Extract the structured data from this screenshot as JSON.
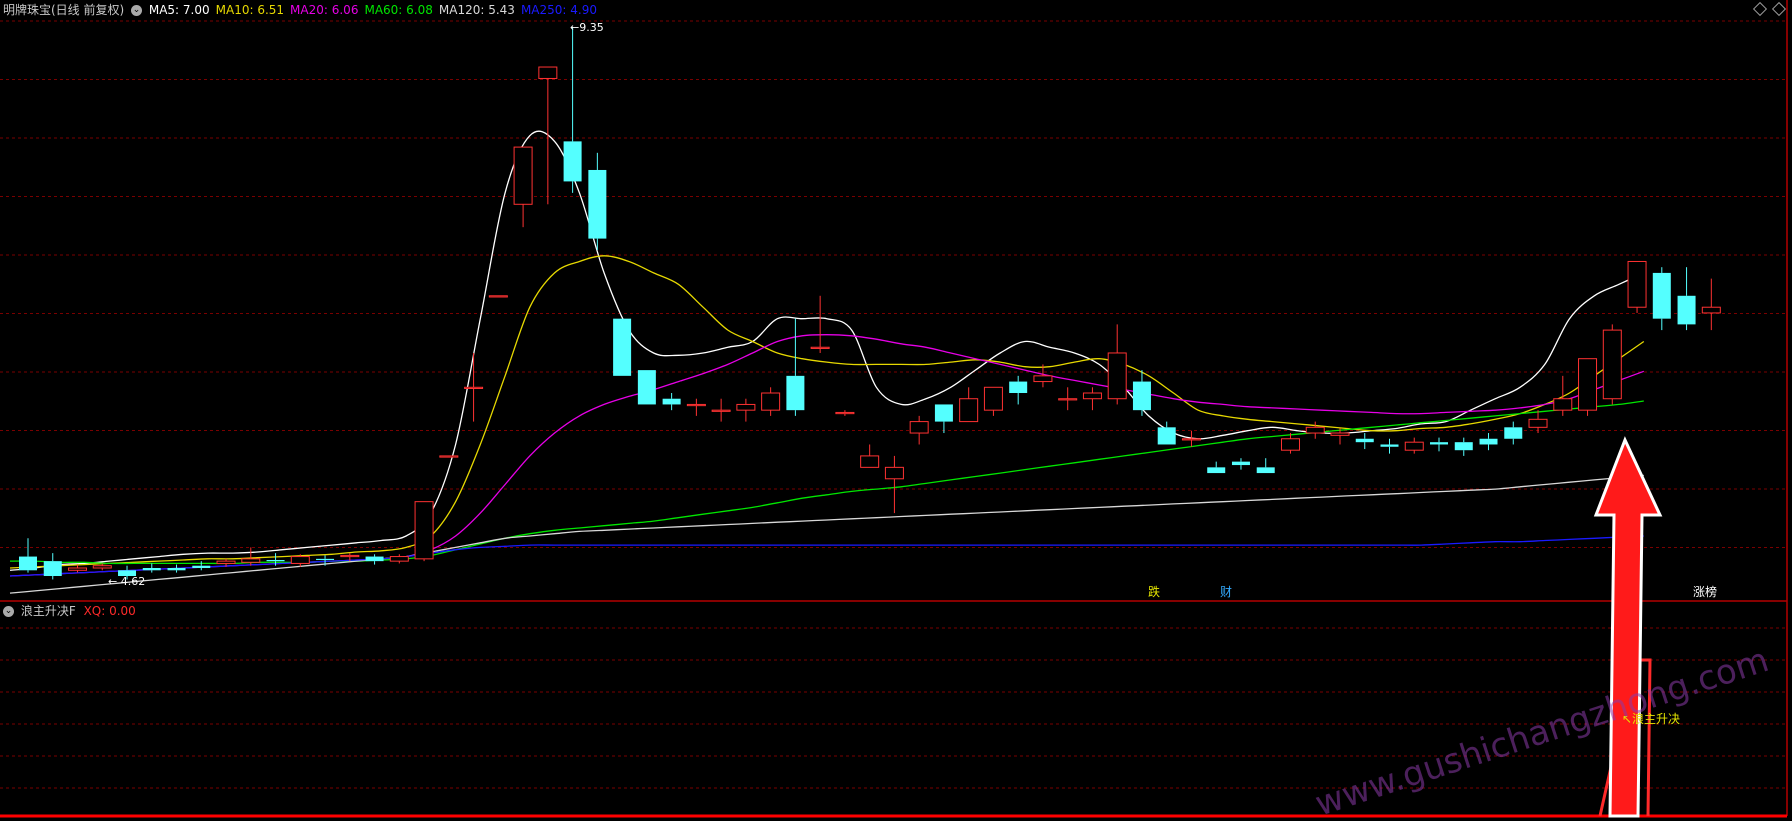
{
  "chart_data": [
    {
      "type": "candlestick",
      "title": "明牌珠宝(日线 前复权)",
      "ylim": [
        4.2,
        9.5
      ],
      "grid": true,
      "moving_averages": [
        {
          "name": "MA5",
          "value": "7.00",
          "color": "#ffffff",
          "values": [
            4.6,
            4.62,
            4.65,
            4.66,
            4.68,
            4.7,
            4.72,
            4.74,
            4.75,
            4.75,
            4.76,
            4.78,
            4.8,
            4.82,
            4.84,
            4.86,
            4.9,
            5.1,
            5.7,
            6.8,
            7.9,
            8.4,
            8.35,
            7.9,
            7.2,
            6.7,
            6.5,
            6.48,
            6.5,
            6.55,
            6.6,
            6.8,
            6.8,
            6.8,
            6.7,
            6.2,
            6.05,
            6.1,
            6.2,
            6.35,
            6.5,
            6.6,
            6.55,
            6.5,
            6.4,
            6.2,
            5.95,
            5.8,
            5.75,
            5.78,
            5.82,
            5.85,
            5.82,
            5.8,
            5.8,
            5.82,
            5.84,
            5.88,
            5.9,
            6.0,
            6.1,
            6.2,
            6.4,
            6.8,
            7.0,
            7.1,
            7.2
          ]
        },
        {
          "name": "MA10",
          "value": "6.51",
          "color": "#e6d800",
          "values": [
            4.62,
            4.63,
            4.64,
            4.65,
            4.66,
            4.67,
            4.68,
            4.69,
            4.7,
            4.7,
            4.71,
            4.72,
            4.73,
            4.74,
            4.76,
            4.77,
            4.8,
            4.9,
            5.2,
            5.7,
            6.3,
            6.9,
            7.2,
            7.3,
            7.35,
            7.3,
            7.2,
            7.1,
            6.9,
            6.7,
            6.6,
            6.5,
            6.45,
            6.42,
            6.4,
            6.4,
            6.4,
            6.4,
            6.42,
            6.44,
            6.42,
            6.38,
            6.38,
            6.42,
            6.45,
            6.4,
            6.3,
            6.15,
            6.0,
            5.95,
            5.92,
            5.9,
            5.88,
            5.86,
            5.84,
            5.82,
            5.82,
            5.84,
            5.85,
            5.88,
            5.92,
            5.97,
            6.05,
            6.15,
            6.3,
            6.45,
            6.6
          ]
        },
        {
          "name": "MA20",
          "value": "6.06",
          "color": "#e600e6",
          "values": [
            4.55,
            4.56,
            4.57,
            4.58,
            4.59,
            4.6,
            4.61,
            4.62,
            4.63,
            4.64,
            4.65,
            4.66,
            4.67,
            4.68,
            4.69,
            4.7,
            4.72,
            4.78,
            4.9,
            5.1,
            5.35,
            5.6,
            5.8,
            5.95,
            6.05,
            6.12,
            6.18,
            6.25,
            6.32,
            6.4,
            6.5,
            6.6,
            6.65,
            6.66,
            6.65,
            6.62,
            6.58,
            6.55,
            6.5,
            6.45,
            6.4,
            6.35,
            6.3,
            6.26,
            6.22,
            6.18,
            6.14,
            6.1,
            6.07,
            6.05,
            6.03,
            6.02,
            6.01,
            6.0,
            5.99,
            5.98,
            5.97,
            5.97,
            5.98,
            5.99,
            6.0,
            6.02,
            6.05,
            6.1,
            6.18,
            6.26,
            6.34
          ]
        },
        {
          "name": "MA60",
          "value": "6.08",
          "color": "#00e600",
          "values": [
            4.68,
            4.68,
            4.67,
            4.67,
            4.66,
            4.66,
            4.66,
            4.66,
            4.66,
            4.66,
            4.67,
            4.67,
            4.67,
            4.68,
            4.68,
            4.69,
            4.7,
            4.73,
            4.78,
            4.83,
            4.88,
            4.92,
            4.95,
            4.97,
            4.99,
            5.01,
            5.03,
            5.06,
            5.09,
            5.12,
            5.15,
            5.19,
            5.23,
            5.26,
            5.29,
            5.31,
            5.33,
            5.36,
            5.39,
            5.42,
            5.45,
            5.48,
            5.51,
            5.54,
            5.57,
            5.6,
            5.63,
            5.66,
            5.69,
            5.72,
            5.75,
            5.77,
            5.79,
            5.81,
            5.83,
            5.85,
            5.87,
            5.89,
            5.91,
            5.93,
            5.95,
            5.97,
            5.99,
            6.01,
            6.03,
            6.05,
            6.08
          ]
        },
        {
          "name": "MA120",
          "value": "5.43",
          "color": "#d8d8d8",
          "values": [
            4.4,
            4.42,
            4.44,
            4.46,
            4.48,
            4.5,
            4.52,
            4.54,
            4.56,
            4.58,
            4.6,
            4.62,
            4.64,
            4.66,
            4.68,
            4.7,
            4.72,
            4.76,
            4.8,
            4.84,
            4.88,
            4.9,
            4.92,
            4.94,
            4.95,
            4.96,
            4.97,
            4.98,
            4.99,
            5.0,
            5.01,
            5.02,
            5.03,
            5.04,
            5.05,
            5.06,
            5.07,
            5.08,
            5.09,
            5.1,
            5.11,
            5.12,
            5.13,
            5.14,
            5.15,
            5.16,
            5.17,
            5.18,
            5.19,
            5.2,
            5.21,
            5.22,
            5.23,
            5.24,
            5.25,
            5.26,
            5.27,
            5.28,
            5.29,
            5.3,
            5.31,
            5.33,
            5.35,
            5.37,
            5.39,
            5.41,
            5.43
          ]
        },
        {
          "name": "MA250",
          "value": "4.90",
          "color": "#1a1aff",
          "values": [
            4.55,
            4.56,
            4.57,
            4.58,
            4.59,
            4.6,
            4.61,
            4.62,
            4.63,
            4.64,
            4.65,
            4.66,
            4.67,
            4.68,
            4.69,
            4.7,
            4.72,
            4.75,
            4.78,
            4.8,
            4.81,
            4.82,
            4.82,
            4.82,
            4.82,
            4.82,
            4.82,
            4.82,
            4.82,
            4.82,
            4.82,
            4.82,
            4.82,
            4.82,
            4.82,
            4.82,
            4.82,
            4.82,
            4.82,
            4.82,
            4.82,
            4.82,
            4.82,
            4.82,
            4.82,
            4.82,
            4.82,
            4.82,
            4.82,
            4.82,
            4.82,
            4.82,
            4.82,
            4.82,
            4.82,
            4.82,
            4.82,
            4.82,
            4.83,
            4.84,
            4.85,
            4.85,
            4.86,
            4.87,
            4.88,
            4.89,
            4.9
          ]
        }
      ],
      "candles": [
        [
          4.72,
          4.6,
          4.88,
          4.58
        ],
        [
          4.68,
          4.55,
          4.75,
          4.52
        ],
        [
          4.6,
          4.62,
          4.65,
          4.58
        ],
        [
          4.62,
          4.64,
          4.66,
          4.6
        ],
        [
          4.6,
          4.55,
          4.64,
          4.52
        ],
        [
          4.62,
          4.6,
          4.66,
          4.58
        ],
        [
          4.62,
          4.6,
          4.65,
          4.58
        ],
        [
          4.64,
          4.62,
          4.68,
          4.6
        ],
        [
          4.66,
          4.68,
          4.7,
          4.63
        ],
        [
          4.67,
          4.7,
          4.8,
          4.64
        ],
        [
          4.69,
          4.68,
          4.75,
          4.64
        ],
        [
          4.66,
          4.72,
          4.74,
          4.63
        ],
        [
          4.7,
          4.69,
          4.73,
          4.64
        ],
        [
          4.72,
          4.73,
          4.75,
          4.68
        ],
        [
          4.72,
          4.68,
          4.74,
          4.65
        ],
        [
          4.68,
          4.72,
          4.74,
          4.66
        ],
        [
          4.7,
          5.2,
          5.2,
          4.68
        ],
        [
          5.6,
          5.6,
          5.6,
          5.6
        ],
        [
          6.2,
          6.2,
          6.5,
          5.9
        ],
        [
          7.0,
          7.0,
          7.0,
          7.0
        ],
        [
          7.8,
          8.3,
          8.3,
          7.6
        ],
        [
          8.9,
          9.0,
          9.0,
          7.8
        ],
        [
          8.35,
          8.0,
          9.35,
          7.9
        ],
        [
          8.1,
          7.5,
          8.25,
          7.4
        ],
        [
          6.8,
          6.3,
          6.8,
          6.3
        ],
        [
          6.35,
          6.05,
          6.35,
          6.05
        ],
        [
          6.1,
          6.05,
          6.15,
          6.0
        ],
        [
          6.05,
          6.05,
          6.1,
          5.95
        ],
        [
          6.0,
          6.0,
          6.1,
          5.9
        ],
        [
          6.0,
          6.05,
          6.1,
          5.9
        ],
        [
          6.0,
          6.15,
          6.2,
          5.95
        ],
        [
          6.3,
          6.0,
          6.8,
          5.95
        ],
        [
          6.55,
          6.55,
          7.0,
          6.5
        ],
        [
          5.98,
          5.98,
          6.0,
          5.95
        ],
        [
          5.5,
          5.6,
          5.7,
          5.55
        ],
        [
          5.4,
          5.5,
          5.6,
          5.1
        ],
        [
          5.8,
          5.9,
          5.95,
          5.7
        ],
        [
          6.05,
          5.9,
          6.05,
          5.8
        ],
        [
          5.9,
          6.1,
          6.2,
          5.9
        ],
        [
          6.0,
          6.2,
          6.2,
          5.95
        ],
        [
          6.25,
          6.15,
          6.3,
          6.05
        ],
        [
          6.25,
          6.3,
          6.4,
          6.2
        ],
        [
          6.1,
          6.1,
          6.2,
          6.0
        ],
        [
          6.1,
          6.15,
          6.2,
          6.0
        ],
        [
          6.1,
          6.5,
          6.75,
          6.05
        ],
        [
          6.25,
          6.0,
          6.35,
          5.95
        ],
        [
          5.85,
          5.7,
          5.9,
          5.7
        ],
        [
          5.75,
          5.75,
          5.82,
          5.68
        ],
        [
          5.5,
          5.45,
          5.55,
          5.45
        ],
        [
          5.55,
          5.52,
          5.58,
          5.48
        ],
        [
          5.5,
          5.45,
          5.58,
          5.45
        ],
        [
          5.65,
          5.75,
          5.8,
          5.62
        ],
        [
          5.8,
          5.85,
          5.9,
          5.75
        ],
        [
          5.78,
          5.8,
          5.84,
          5.7
        ],
        [
          5.75,
          5.72,
          5.8,
          5.66
        ],
        [
          5.7,
          5.68,
          5.75,
          5.62
        ],
        [
          5.65,
          5.72,
          5.76,
          5.62
        ],
        [
          5.72,
          5.7,
          5.76,
          5.64
        ],
        [
          5.72,
          5.65,
          5.76,
          5.6
        ],
        [
          5.75,
          5.7,
          5.8,
          5.65
        ],
        [
          5.85,
          5.75,
          5.9,
          5.7
        ],
        [
          5.85,
          5.92,
          6.0,
          5.8
        ],
        [
          6.0,
          6.1,
          6.3,
          5.95
        ],
        [
          6.0,
          6.45,
          6.45,
          5.95
        ],
        [
          6.1,
          6.7,
          6.75,
          6.05
        ],
        [
          6.9,
          7.3,
          7.3,
          6.85
        ],
        [
          7.2,
          6.8,
          7.25,
          6.7
        ],
        [
          7.0,
          6.75,
          7.25,
          6.7
        ],
        [
          6.85,
          6.9,
          7.15,
          6.7
        ]
      ],
      "annotations": [
        {
          "text": "9.35",
          "price": 9.35
        },
        {
          "text": "4.62",
          "price": 4.62
        }
      ],
      "tags": [
        {
          "text": "跌",
          "color": "#e6e600"
        },
        {
          "text": "财",
          "color": "#33aaff"
        },
        {
          "text": "涨榜",
          "color": "#ffffff"
        }
      ]
    },
    {
      "type": "line",
      "title": "浪主升决F",
      "series": [
        {
          "name": "XQ",
          "value": "0.00",
          "color": "#ff2a2a"
        }
      ],
      "signal_label": "浪主升决"
    }
  ],
  "watermark": "www.gushichangzhong.com",
  "colors": {
    "up": "#ff3232",
    "down": "#54ffff",
    "grid": "#7a0000",
    "frame": "#b40000",
    "arrow": "#ff1a1a"
  }
}
